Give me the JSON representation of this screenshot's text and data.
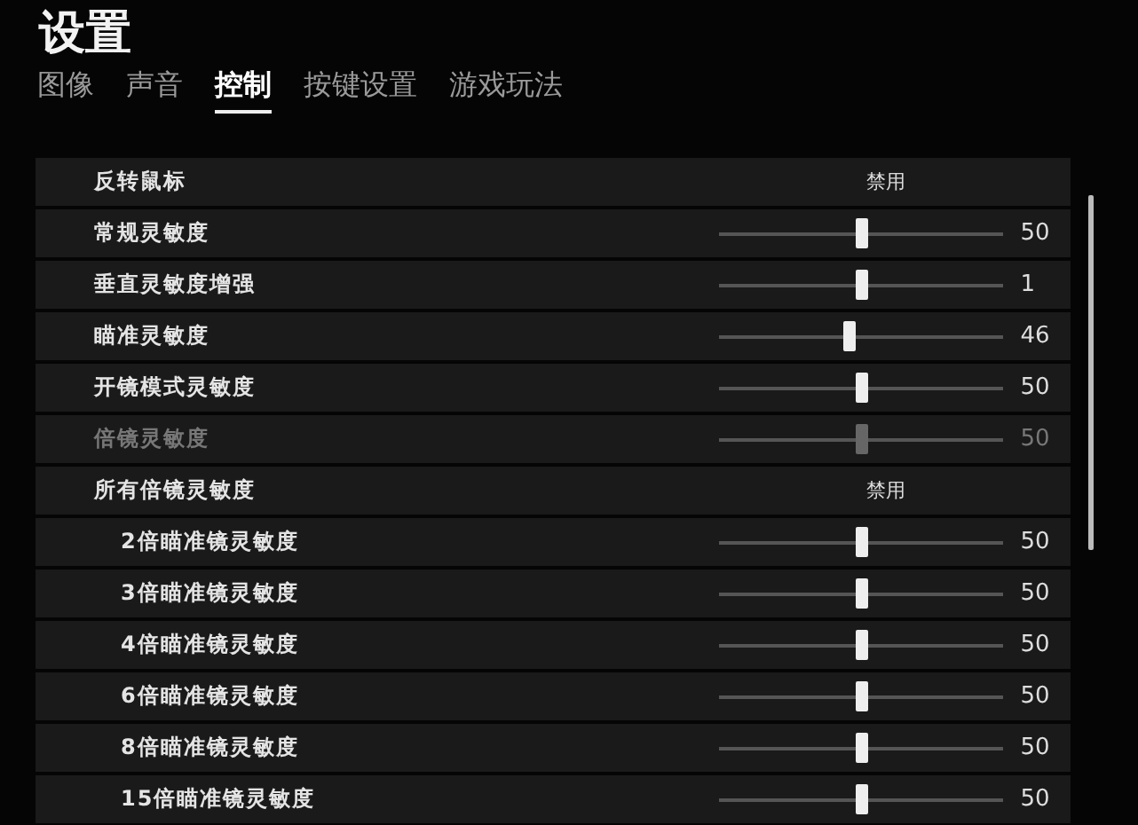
{
  "title": "设置",
  "tabs": [
    {
      "label": "图像",
      "selected": false
    },
    {
      "label": "声音",
      "selected": false
    },
    {
      "label": "控制",
      "selected": true
    },
    {
      "label": "按键设置",
      "selected": false
    },
    {
      "label": "游戏玩法",
      "selected": false
    }
  ],
  "settings": [
    {
      "kind": "toggle",
      "label": "反转鼠标",
      "value": "禁用"
    },
    {
      "kind": "slider",
      "label": "常规灵敏度",
      "level": 0.5,
      "value": "50",
      "disabled": false
    },
    {
      "kind": "slider",
      "label": "垂直灵敏度增强",
      "level": 0.5,
      "value": "1",
      "disabled": false
    },
    {
      "kind": "slider",
      "label": "瞄准灵敏度",
      "level": 0.46,
      "value": "46",
      "disabled": false
    },
    {
      "kind": "slider",
      "label": "开镜模式灵敏度",
      "level": 0.5,
      "value": "50",
      "disabled": false
    },
    {
      "kind": "slider",
      "label": "倍镜灵敏度",
      "level": 0.5,
      "value": "50",
      "disabled": true
    },
    {
      "kind": "toggle",
      "label": "所有倍镜灵敏度",
      "value": "禁用",
      "children": [
        {
          "kind": "slider",
          "label": "2倍瞄准镜灵敏度",
          "level": 0.5,
          "value": "50",
          "disabled": false
        },
        {
          "kind": "slider",
          "label": "3倍瞄准镜灵敏度",
          "level": 0.5,
          "value": "50",
          "disabled": false
        },
        {
          "kind": "slider",
          "label": "4倍瞄准镜灵敏度",
          "level": 0.5,
          "value": "50",
          "disabled": false
        },
        {
          "kind": "slider",
          "label": "6倍瞄准镜灵敏度",
          "level": 0.5,
          "value": "50",
          "disabled": false
        },
        {
          "kind": "slider",
          "label": "8倍瞄准镜灵敏度",
          "level": 0.5,
          "value": "50",
          "disabled": false
        },
        {
          "kind": "slider",
          "label": "15倍瞄准镜灵敏度",
          "level": 0.5,
          "value": "50",
          "disabled": false
        }
      ]
    }
  ]
}
